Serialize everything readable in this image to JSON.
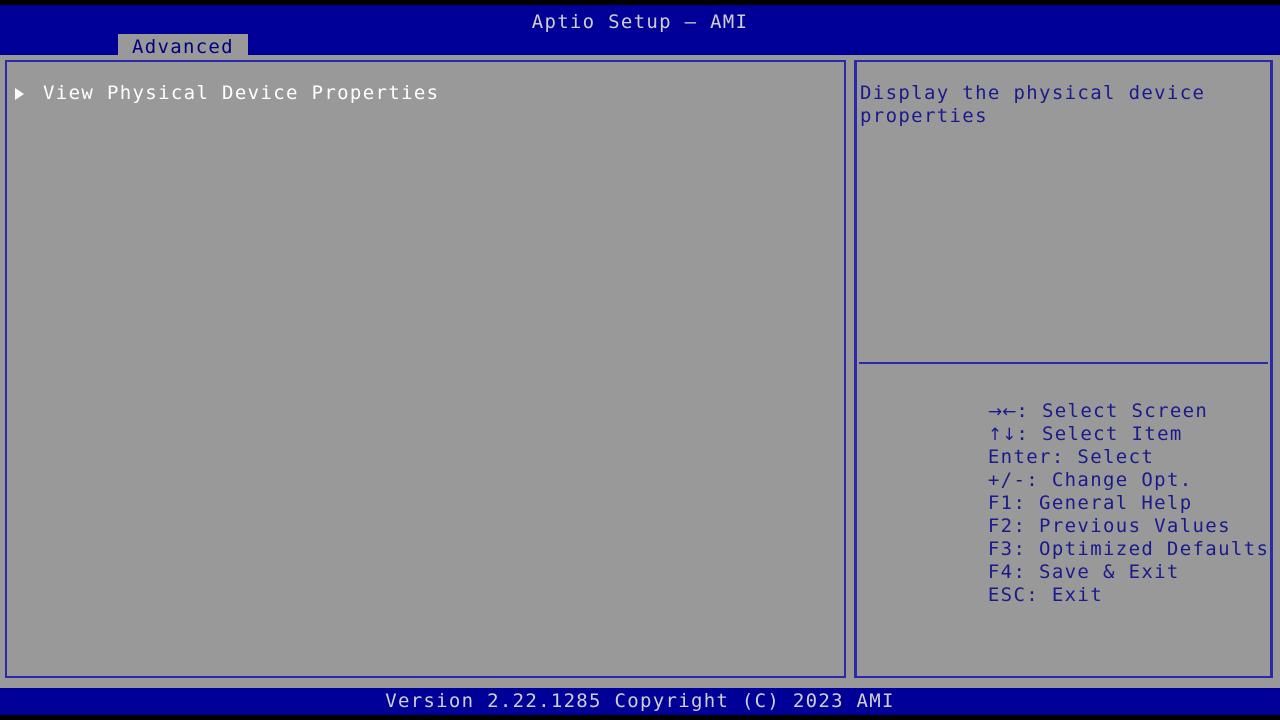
{
  "header": {
    "title": "Aptio Setup – AMI",
    "tabs": [
      {
        "label": "Advanced",
        "active": true
      }
    ]
  },
  "main": {
    "menu_items": [
      {
        "label": "View Physical Device Properties",
        "has_submenu": true,
        "selected": true
      }
    ]
  },
  "help": {
    "description": "Display the physical device properties",
    "key_legend": [
      {
        "key": "→←",
        "separator": ": ",
        "action": "Select Screen",
        "glyph": true
      },
      {
        "key": "↑↓",
        "separator": ": ",
        "action": "Select Item",
        "glyph": true
      },
      {
        "key": "Enter",
        "separator": ": ",
        "action": "Select",
        "glyph": false
      },
      {
        "key": "+/-",
        "separator": ": ",
        "action": "Change Opt.",
        "glyph": false
      },
      {
        "key": "F1",
        "separator": ": ",
        "action": "General Help",
        "glyph": false
      },
      {
        "key": "F2",
        "separator": ": ",
        "action": "Previous Values",
        "glyph": false
      },
      {
        "key": "F3",
        "separator": ": ",
        "action": "Optimized Defaults",
        "glyph": false
      },
      {
        "key": "F4",
        "separator": ": ",
        "action": "Save & Exit",
        "glyph": false
      },
      {
        "key": "ESC",
        "separator": ": ",
        "action": "Exit",
        "glyph": false
      }
    ]
  },
  "footer": {
    "version_text": "Version 2.22.1285 Copyright (C) 2023 AMI"
  },
  "colors": {
    "header_blue": "#000099",
    "panel_gray": "#999999",
    "border_blue": "#2a2aa8",
    "help_text_blue": "#1a1a8c",
    "menu_text_white": "#ffffff",
    "tab_text_blue": "#000080",
    "footer_text": "#cfcfcf"
  }
}
